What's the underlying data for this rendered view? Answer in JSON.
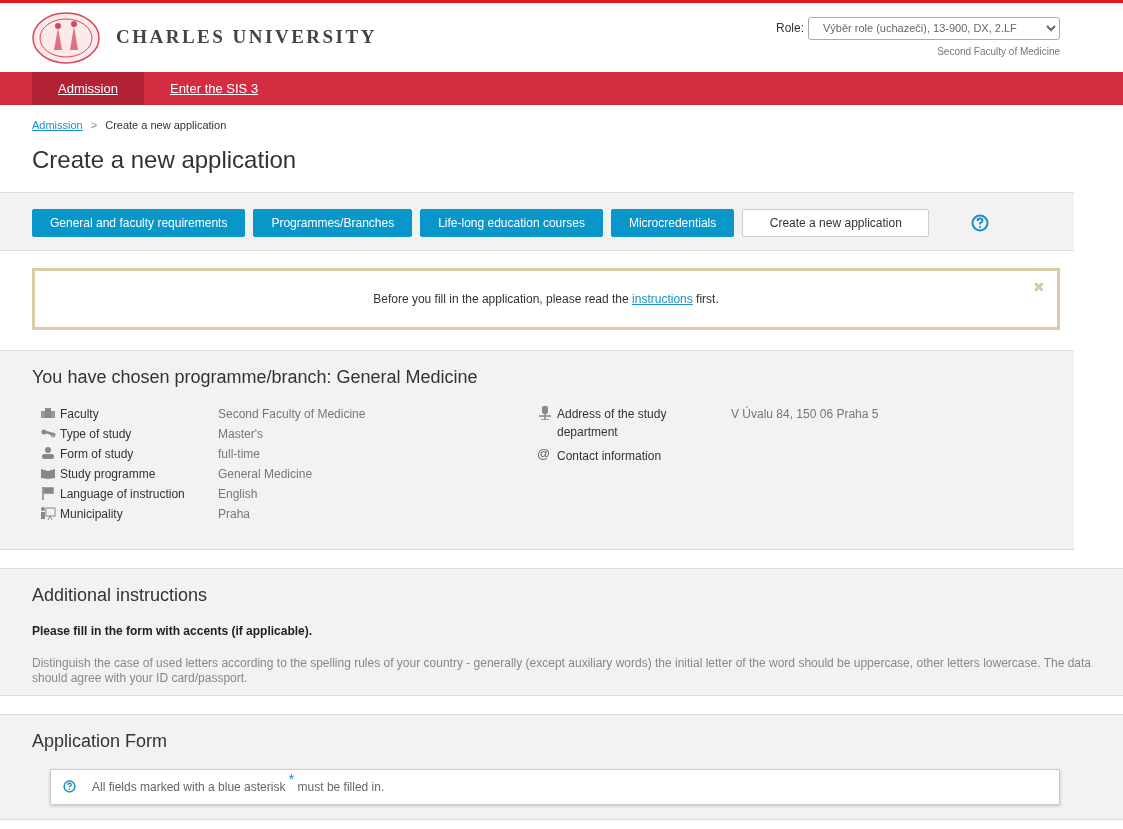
{
  "header": {
    "logo_text": "CHARLES UNIVERSITY",
    "role_label": "Role:",
    "role_value": "Výběr role (uchazeči), 13-900, DX, 2.LF",
    "faculty": "Second Faculty of Medicine"
  },
  "nav": [
    {
      "label": "Admission",
      "selected": true
    },
    {
      "label": "Enter the SIS 3",
      "selected": false
    }
  ],
  "breadcrumb": {
    "link": "Admission",
    "separator": ">",
    "current": "Create a new application"
  },
  "page_title": "Create a new application",
  "tabs": [
    {
      "label": "General and faculty requirements",
      "selected": false
    },
    {
      "label": "Programmes/Branches",
      "selected": false
    },
    {
      "label": "Life-long education courses",
      "selected": false
    },
    {
      "label": "Microcredentials",
      "selected": false
    },
    {
      "label": "Create a new application",
      "selected": true
    }
  ],
  "alert": {
    "before": "Before you fill in the application, please read the",
    "link": "instructions",
    "after": "first.",
    "close": "✖"
  },
  "programme": {
    "title": "You have chosen programme/branch: General Medicine",
    "left": [
      {
        "label": "Faculty",
        "value": "Second Faculty of Medicine"
      },
      {
        "label": "Type of study",
        "value": "Master's"
      },
      {
        "label": "Form of study",
        "value": "full-time"
      },
      {
        "label": "Study programme",
        "value": "General Medicine"
      },
      {
        "label": "Language of instruction",
        "value": "English"
      },
      {
        "label": "Municipality",
        "value": "Praha"
      }
    ],
    "right": [
      {
        "label": "Address of the study department",
        "value": "V Úvalu 84, 150 06 Praha 5"
      },
      {
        "label": "Contact information",
        "icon_char": "@"
      }
    ]
  },
  "instructions": {
    "title": "Additional instructions",
    "bold_note": "Please fill in the form with accents (if applicable).",
    "text": "Distinguish the case of used letters according to the spelling rules of your country - generally (except auxiliary words) the initial letter of the word should be uppercase, other letters lowercase. The data should agree with your ID card/passport."
  },
  "application_form": {
    "title": "Application Form",
    "note": "All fields marked with a blue asterisk $^{*}$ must be filled in."
  }
}
